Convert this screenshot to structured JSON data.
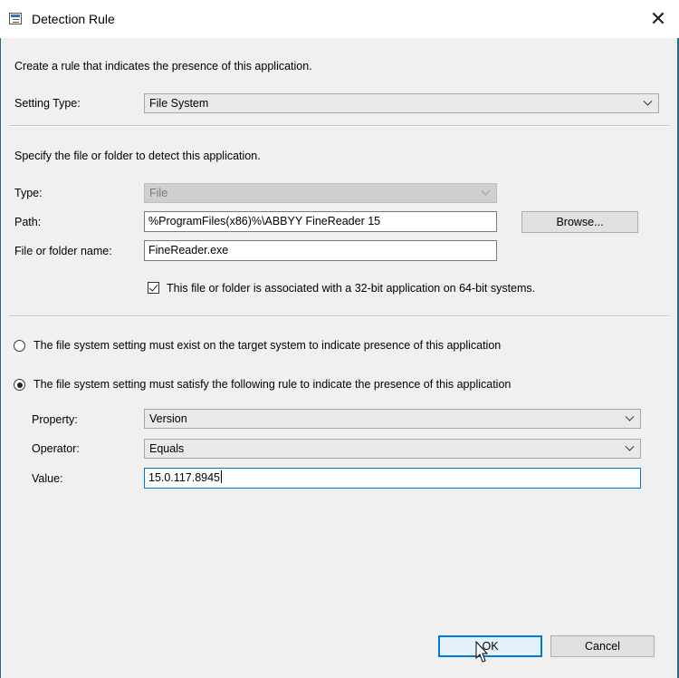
{
  "window": {
    "title": "Detection Rule",
    "close_glyph": "✕"
  },
  "intro_text": "Create a rule that indicates the presence of this application.",
  "setting_type": {
    "label": "Setting Type:",
    "value": "File System"
  },
  "specify_text": "Specify the file or folder to detect this application.",
  "type_field": {
    "label": "Type:",
    "value": "File"
  },
  "path_field": {
    "label": "Path:",
    "value": "%ProgramFiles(x86)%\\ABBYY FineReader 15"
  },
  "browse_label": "Browse...",
  "name_field": {
    "label": "File or folder name:",
    "value": "FineReader.exe"
  },
  "bit32_checkbox": {
    "label": "This file or folder is associated with a 32-bit application on 64-bit systems.",
    "checked": true
  },
  "radio_exist": {
    "label": "The file system setting must exist on the target system to indicate presence of this application",
    "selected": false
  },
  "radio_rule": {
    "label": "The file system setting must satisfy the following rule to indicate the presence of this application",
    "selected": true
  },
  "property_field": {
    "label": "Property:",
    "value": "Version"
  },
  "operator_field": {
    "label": "Operator:",
    "value": "Equals"
  },
  "value_field": {
    "label": "Value:",
    "value": "15.0.117.8945"
  },
  "ok_label": "OK",
  "cancel_label": "Cancel",
  "colors": {
    "accent": "#0078d7",
    "frame": "#1f6f8b",
    "background": "#f0f0f0"
  }
}
